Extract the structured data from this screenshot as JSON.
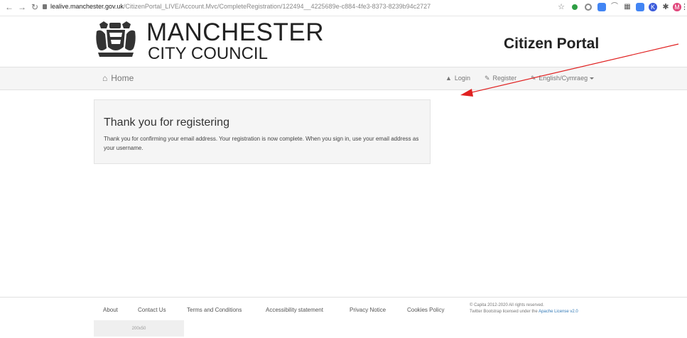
{
  "browser": {
    "url_host": "lealive.manchester.gov.uk",
    "url_path": "/CitizenPortal_LIVE/Account.Mvc/CompleteRegistration/122494__4225689e-c884-4fe3-8373-8239b94c2727",
    "profile_initial": "M",
    "colors": {
      "green": "#2e9e44",
      "blue": "#4285f4",
      "red": "#e04848",
      "profile": "#e0457b"
    }
  },
  "header": {
    "brand_title": "MANCHESTER",
    "brand_subtitle": "CITY COUNCIL",
    "portal_title": "Citizen Portal"
  },
  "nav": {
    "home": "Home",
    "login": "Login",
    "register": "Register",
    "language": "English/Cymraeg"
  },
  "panel": {
    "title": "Thank you for registering",
    "body": "Thank you for confirming your email address. Your registration is now complete. When you sign in, use your email address as your username."
  },
  "footer": {
    "links": [
      "About",
      "Contact Us",
      "Terms and Conditions",
      "Accessibility statement",
      "Privacy Notice",
      "Cookies Policy"
    ],
    "copyright_line1": "© Capita 2012-2020 All rights reserved.",
    "copyright_line2_prefix": "Twitter Bootstrap licensed under the ",
    "license_link": "Apache License v2.0",
    "placeholder": "200x50"
  },
  "annotation": {
    "color": "#e02020"
  }
}
